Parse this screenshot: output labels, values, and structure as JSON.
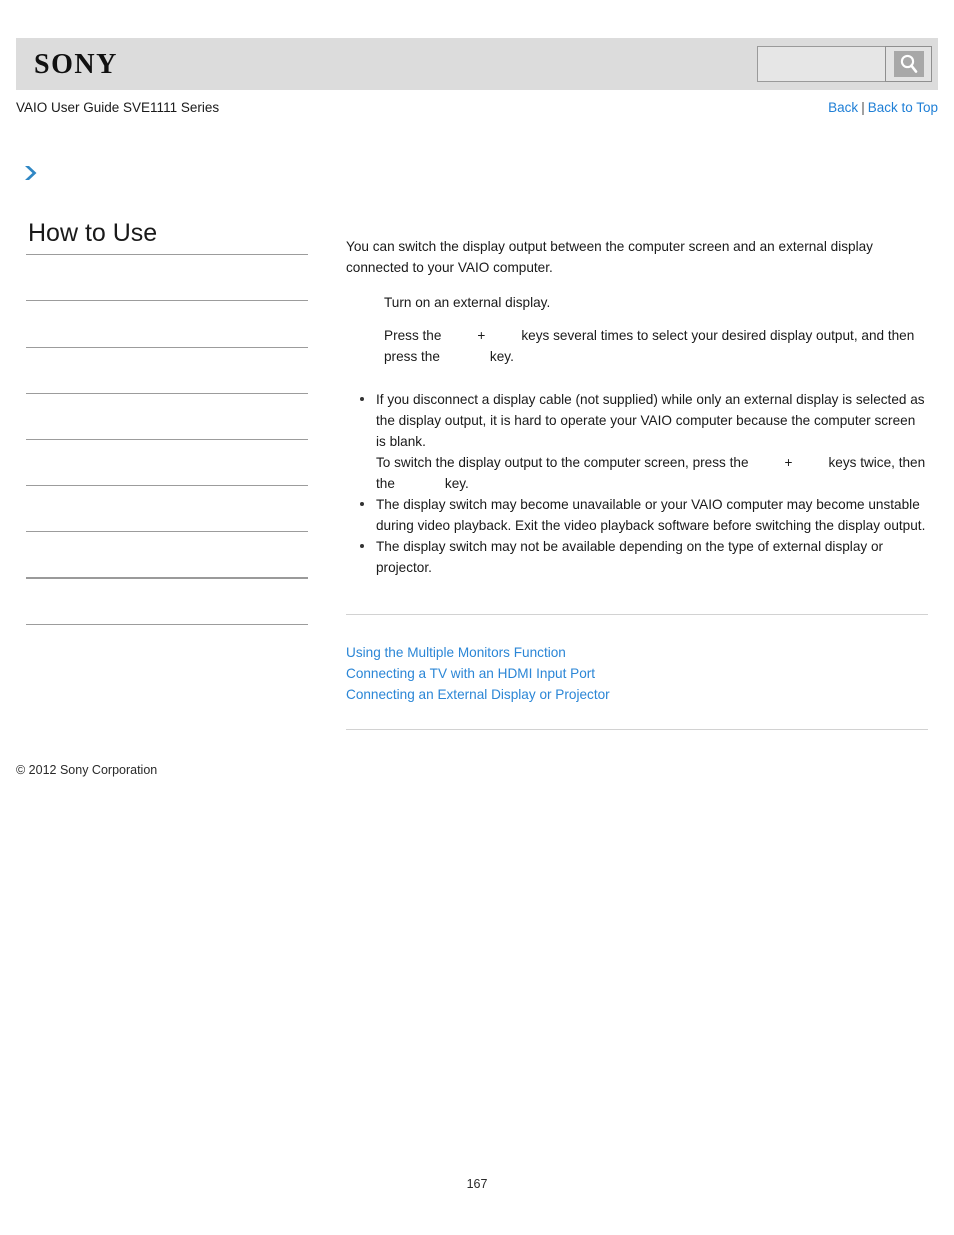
{
  "header": {
    "logo_text": "SONY",
    "search": {
      "value": "",
      "placeholder": "",
      "button_icon": "search-icon"
    }
  },
  "subheader": {
    "guide_title": "VAIO User Guide SVE1111 Series",
    "back_label": "Back",
    "separator": "|",
    "back_to_top_label": "Back to Top"
  },
  "breadcrumb": {
    "icon": "chevron-right-icon",
    "text": ""
  },
  "sidebar": {
    "heading": "How to Use",
    "items": [
      {
        "label": ""
      },
      {
        "label": ""
      },
      {
        "label": ""
      },
      {
        "label": ""
      },
      {
        "label": ""
      },
      {
        "label": ""
      },
      {
        "label": ""
      },
      {
        "label": ""
      },
      {
        "label": ""
      }
    ]
  },
  "content": {
    "intro": "You can switch the display output between the computer screen and an external display connected to your VAIO computer.",
    "steps": [
      {
        "text_parts": [
          "Turn on an external display."
        ]
      },
      {
        "text_before": "Press the",
        "plus": "+",
        "text_mid": "keys several times to select your desired display output, and then press the",
        "text_after": "key."
      }
    ],
    "notes": [
      {
        "line1": "If you disconnect a display cable (not supplied) while only an external display is selected as the display output, it is hard to operate your VAIO computer because the computer screen is blank.",
        "line2_before": "To switch the display output to the computer screen, press the",
        "line2_plus": "+",
        "line2_mid": "keys twice, then the",
        "line2_after": "key."
      },
      {
        "line1": "The display switch may become unavailable or your VAIO computer may become unstable during video playback. Exit the video playback software before switching the display output."
      },
      {
        "line1": "The display switch may not be available depending on the type of external display or projector."
      }
    ],
    "related_links": [
      "Using the Multiple Monitors Function",
      "Connecting a TV with an HDMI Input Port",
      "Connecting an External Display or Projector"
    ]
  },
  "footer": {
    "copyright": "© 2012 Sony Corporation",
    "page_number": "167"
  },
  "colors": {
    "link_blue": "#2b86d6",
    "nav_blue": "#1f7fd6",
    "header_gray": "#dcdcdc",
    "rule_gray": "#d2d2d2",
    "sidebar_rule": "#9c9c9c",
    "accent_chevron": "#2f87c4"
  }
}
